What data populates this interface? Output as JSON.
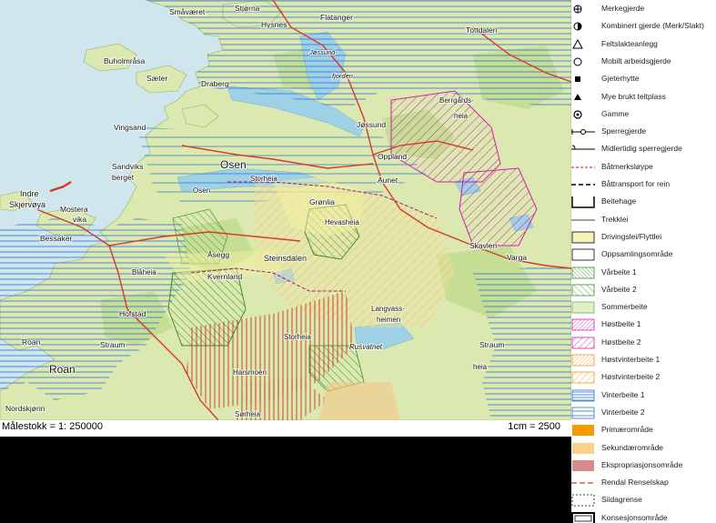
{
  "map": {
    "places": [
      {
        "name": "Småværet",
        "cls": "place",
        "fs": 8.5
      },
      {
        "name": "Stjørna",
        "cls": "place",
        "fs": 8.5
      },
      {
        "name": "Hysnes",
        "cls": "place",
        "fs": 8.5
      },
      {
        "name": "Flatanger",
        "cls": "place",
        "fs": 8.5
      },
      {
        "name": "Tottdalen",
        "cls": "place",
        "fs": 8.5
      },
      {
        "name": "Buholmråsa",
        "cls": "place",
        "fs": 8.5
      },
      {
        "name": "Sæter",
        "cls": "place",
        "fs": 8.5
      },
      {
        "name": "Draberg",
        "cls": "place",
        "fs": 8.5
      },
      {
        "name": "Vingsand",
        "cls": "place",
        "fs": 8.5
      },
      {
        "name": "Jøssund",
        "cls": "place",
        "fs": 8.5
      },
      {
        "name": "Berrgårds-",
        "cls": "area",
        "fs": 8
      },
      {
        "name": "heia",
        "cls": "area",
        "fs": 8
      },
      {
        "name": "Sandviks",
        "cls": "place",
        "fs": 8.5
      },
      {
        "name": "berget",
        "cls": "place",
        "fs": 8.5
      },
      {
        "name": "Osen",
        "cls": "big",
        "fs": 12
      },
      {
        "name": "Oppland",
        "cls": "place",
        "fs": 8.5
      },
      {
        "name": "Aunet",
        "cls": "place",
        "fs": 8.5
      },
      {
        "name": "Storheia",
        "cls": "area",
        "fs": 8
      },
      {
        "name": "Indre",
        "cls": "place",
        "fs": 9
      },
      {
        "name": "Skjervøya",
        "cls": "place",
        "fs": 9
      },
      {
        "name": "Mostera",
        "cls": "place",
        "fs": 8.5
      },
      {
        "name": "vika",
        "cls": "place",
        "fs": 8.5
      },
      {
        "name": "Osen",
        "cls": "place",
        "fs": 8
      },
      {
        "name": "Grønlia",
        "cls": "place",
        "fs": 8.5
      },
      {
        "name": "Hevasheia",
        "cls": "area",
        "fs": 8
      },
      {
        "name": "Bessaker",
        "cls": "place",
        "fs": 8.5
      },
      {
        "name": "Åsegg",
        "cls": "place",
        "fs": 8.5
      },
      {
        "name": "Steinsdalen",
        "cls": "place",
        "fs": 9
      },
      {
        "name": "Skavlen",
        "cls": "place",
        "fs": 8.5
      },
      {
        "name": "Varga",
        "cls": "place",
        "fs": 8.5
      },
      {
        "name": "Blåheia",
        "cls": "area",
        "fs": 8
      },
      {
        "name": "Kvernland",
        "cls": "place",
        "fs": 8.5
      },
      {
        "name": "Langvass-",
        "cls": "area",
        "fs": 8
      },
      {
        "name": "heimen",
        "cls": "area",
        "fs": 8
      },
      {
        "name": "Hofstad",
        "cls": "place",
        "fs": 8.5
      },
      {
        "name": "Storheia",
        "cls": "area",
        "fs": 8
      },
      {
        "name": "Roan",
        "cls": "place",
        "fs": 8.5
      },
      {
        "name": "Straum",
        "cls": "place",
        "fs": 8.5
      },
      {
        "name": "Rusvatnet",
        "cls": "water",
        "fs": 8
      },
      {
        "name": "Straum",
        "cls": "place",
        "fs": 8.5
      },
      {
        "name": "Roan",
        "cls": "big",
        "fs": 12
      },
      {
        "name": "Harsmoen",
        "cls": "area",
        "fs": 8
      },
      {
        "name": "heia",
        "cls": "area",
        "fs": 8
      },
      {
        "name": "Nordskjørin",
        "cls": "place",
        "fs": 8.5
      },
      {
        "name": "Sørheia",
        "cls": "area",
        "fs": 8
      },
      {
        "name": "Jøssund-",
        "cls": "water",
        "fs": 7.5
      },
      {
        "name": "fjorden",
        "cls": "water",
        "fs": 7.5
      }
    ]
  },
  "scale": {
    "left": "Målestokk = 1: 250000",
    "right": "1cm = 2500"
  },
  "legend": {
    "items": [
      {
        "label": "Merkegjerde",
        "sym": "circle-cross"
      },
      {
        "label": "Kombinert gjerde (Merk/Slakt)",
        "sym": "half-circle"
      },
      {
        "label": "Feltslakteanlegg",
        "sym": "triangle-open"
      },
      {
        "label": "Mobilt arbeidsgjerde",
        "sym": "circle-open"
      },
      {
        "label": "Gjeterhytte",
        "sym": "square-black"
      },
      {
        "label": "Mye brukt teltplass",
        "sym": "triangle-black"
      },
      {
        "label": "Gamme",
        "sym": "circle-dot"
      },
      {
        "label": "Sperregjerde",
        "sym": "line-ring"
      },
      {
        "label": "Midlertidig sperregjerde",
        "sym": "line-temp"
      },
      {
        "label": "Båtmerksløype",
        "sym": "dash-brown"
      },
      {
        "label": "Båttransport for rein",
        "sym": "dash-black"
      },
      {
        "label": "Beitehage",
        "sym": "bracket"
      },
      {
        "label": "Trekklei",
        "sym": "line-thin"
      },
      {
        "label": "Drivingslei/Flyttlei",
        "sym": "box-yellow"
      },
      {
        "label": "Oppsamlingsområde",
        "sym": "box-open"
      },
      {
        "label": "Vårbeite 1",
        "sym": "hatch-green-dense"
      },
      {
        "label": "Vårbeite 2",
        "sym": "hatch-green-sparse"
      },
      {
        "label": "Sommerbeite",
        "sym": "box-lightgreen"
      },
      {
        "label": "Høstbeite 1",
        "sym": "hatch-pink-dense"
      },
      {
        "label": "Høstbeite 2",
        "sym": "hatch-pink-sparse"
      },
      {
        "label": "Høstvinterbeite 1",
        "sym": "hatch-orange-dense"
      },
      {
        "label": "Høstvinterbeite 2",
        "sym": "hatch-orange-sparse"
      },
      {
        "label": "Vinterbeite 1",
        "sym": "hz-blue-dense"
      },
      {
        "label": "Vinterbeite 2",
        "sym": "hz-blue-sparse"
      },
      {
        "label": "Primærområde",
        "sym": "box-orange"
      },
      {
        "label": "Sekundærområde",
        "sym": "box-peach"
      },
      {
        "label": "Ekspropriasjonsområde",
        "sym": "box-rose"
      },
      {
        "label": "Rendal Renselskap",
        "sym": "dash-red"
      },
      {
        "label": "Siidagrense",
        "sym": "box-dotted"
      },
      {
        "label": "Konsesjonsområde",
        "sym": "box-double"
      }
    ]
  },
  "colors": {
    "sea": "#cfe6ec",
    "land": "#dbe9b0",
    "forest": "#c6de93",
    "water": "#9ed0e6",
    "road": "#d63a2e",
    "hatchBlue": "#2a6fd6",
    "pink": "#d020a8",
    "green": "#3c8f2a",
    "orange": "#e89a20",
    "primary": "#f59b00",
    "secondary": "#fdd08a",
    "expropriation": "#d98a8a"
  }
}
